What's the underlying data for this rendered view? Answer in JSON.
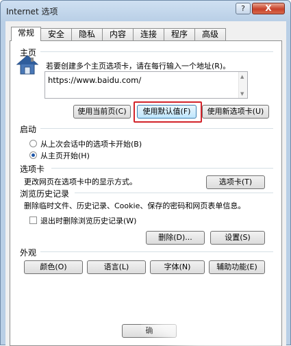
{
  "window": {
    "title": "Internet 选项",
    "help_label": "?",
    "close_label": "X"
  },
  "tabs": [
    {
      "label": "常规",
      "active": true
    },
    {
      "label": "安全"
    },
    {
      "label": "隐私"
    },
    {
      "label": "内容"
    },
    {
      "label": "连接"
    },
    {
      "label": "程序"
    },
    {
      "label": "高级"
    }
  ],
  "home": {
    "heading": "主页",
    "hint": "若要创建多个主页选项卡，请在每行输入一个地址(R)。",
    "url_value": "https://www.baidu.com/",
    "btn_current": "使用当前页(C)",
    "btn_default": "使用默认值(F)",
    "btn_newtab": "使用新选项卡(U)"
  },
  "startup": {
    "heading": "启动",
    "option_last": "从上次会话中的选项卡开始(B)",
    "option_home": "从主页开始(H)"
  },
  "tabsec": {
    "heading": "选项卡",
    "desc": "更改网页在选项卡中的显示方式。",
    "btn": "选项卡(T)"
  },
  "history": {
    "heading": "浏览历史记录",
    "desc": "删除临时文件、历史记录、Cookie、保存的密码和网页表单信息。",
    "check_label": "退出时删除浏览历史记录(W)",
    "btn_delete": "删除(D)...",
    "btn_settings": "设置(S)"
  },
  "appearance": {
    "heading": "外观",
    "btn_colors": "颜色(O)",
    "btn_languages": "语言(L)",
    "btn_fonts": "字体(N)",
    "btn_accessibility": "辅助功能(E)"
  },
  "footer": {
    "btn_ok": "确"
  }
}
